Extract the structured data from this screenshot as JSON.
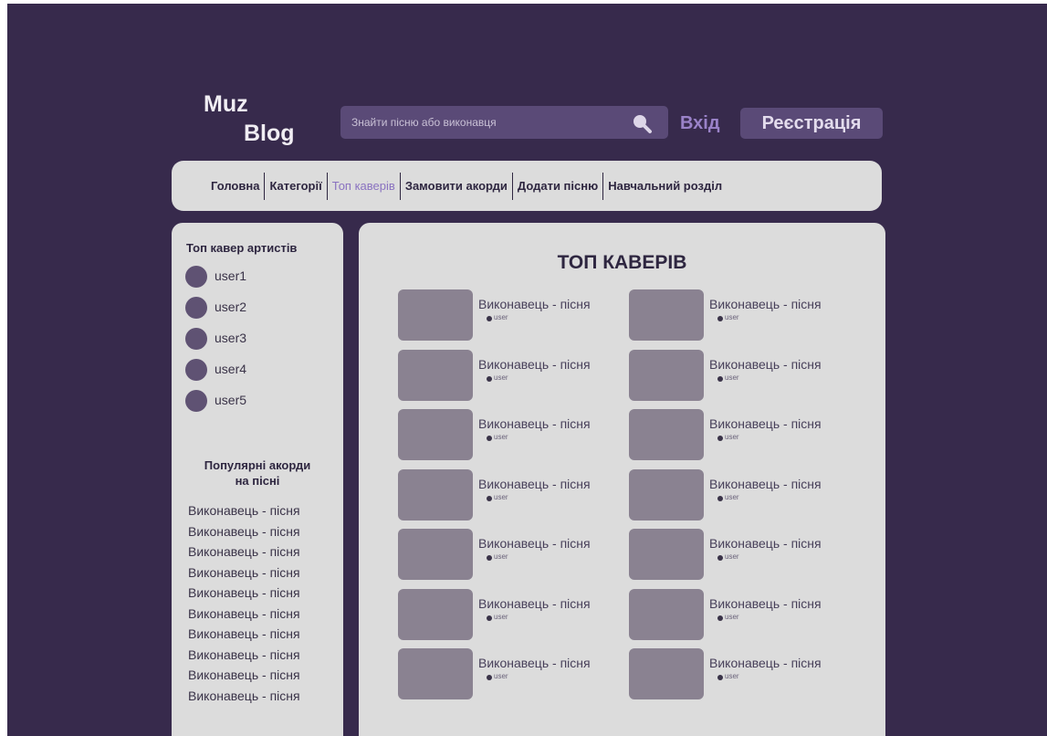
{
  "header": {
    "logo_line1": "Muz",
    "logo_line2": "Blog",
    "search_placeholder": "Знайти пісню або виконавця",
    "login_label": "Вхід",
    "register_label": "Реєстрація"
  },
  "nav": {
    "items": [
      {
        "label": "Головна",
        "active": false
      },
      {
        "label": "Категорії",
        "active": false
      },
      {
        "label": "Топ каверів",
        "active": true
      },
      {
        "label": "Замовити акорди",
        "active": false
      },
      {
        "label": "Додати пісню",
        "active": false
      },
      {
        "label": "Навчальний розділ",
        "active": false
      }
    ]
  },
  "sidebar": {
    "artists_title": "Топ кавер артистів",
    "artists": [
      "user1",
      "user2",
      "user3",
      "user4",
      "user5"
    ],
    "popular_title_line1": "Популярні акорди",
    "popular_title_line2": "на пісні",
    "popular_items": [
      "Виконавець - пісня",
      "Виконавець - пісня",
      "Виконавець - пісня",
      "Виконавець - пісня",
      "Виконавець - пісня",
      "Виконавець - пісня",
      "Виконавець - пісня",
      "Виконавець - пісня",
      "Виконавець - пісня",
      "Виконавець - пісня"
    ]
  },
  "main": {
    "title": "ТОП КАВЕРІВ",
    "covers": [
      {
        "title": "Виконавець - пісня",
        "user": "user"
      },
      {
        "title": "Виконавець - пісня",
        "user": "user"
      },
      {
        "title": "Виконавець - пісня",
        "user": "user"
      },
      {
        "title": "Виконавець - пісня",
        "user": "user"
      },
      {
        "title": "Виконавець - пісня",
        "user": "user"
      },
      {
        "title": "Виконавець - пісня",
        "user": "user"
      },
      {
        "title": "Виконавець - пісня",
        "user": "user"
      },
      {
        "title": "Виконавець - пісня",
        "user": "user"
      },
      {
        "title": "Виконавець - пісня",
        "user": "user"
      },
      {
        "title": "Виконавець - пісня",
        "user": "user"
      },
      {
        "title": "Виконавець - пісня",
        "user": "user"
      },
      {
        "title": "Виконавець - пісня",
        "user": "user"
      },
      {
        "title": "Виконавець - пісня",
        "user": "user"
      },
      {
        "title": "Виконавець - пісня",
        "user": "user"
      }
    ]
  },
  "colors": {
    "background": "#372a4c",
    "panel": "#dcdcdc",
    "accent": "#5a4a77",
    "active_link": "#8a72c0"
  }
}
